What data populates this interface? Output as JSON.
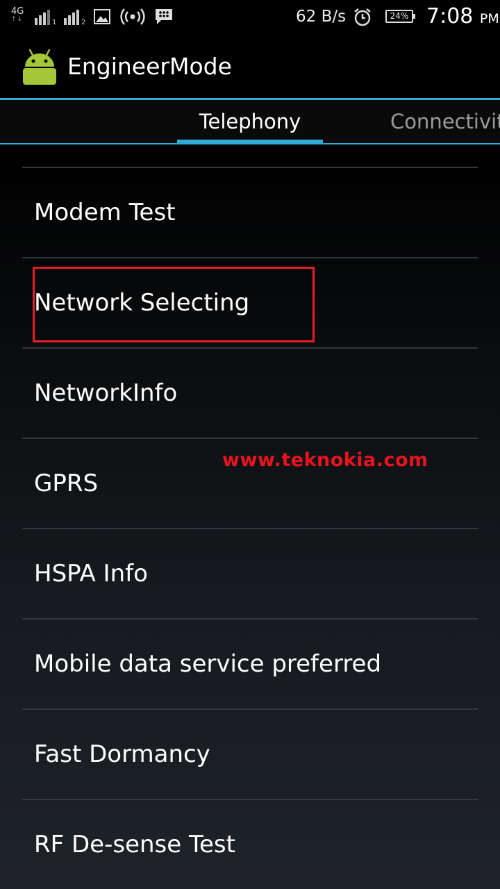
{
  "status_bar": {
    "network_type": "4G",
    "sim1_label": "1",
    "sim2_label": "2",
    "data_rate": "62 B/s",
    "battery": "24%",
    "time": "7:08",
    "ampm": "PM",
    "icons": [
      "lte-icon",
      "signal-sim1-icon",
      "signal-sim2-icon",
      "image-icon",
      "hotspot-icon",
      "bbm-icon",
      "alarm-icon",
      "battery-icon"
    ]
  },
  "app_bar": {
    "title": "EngineerMode",
    "icon": "android-icon"
  },
  "tabs": [
    {
      "label": "Telephony",
      "selected": true
    },
    {
      "label": "Connectivit",
      "selected": false
    }
  ],
  "list": {
    "items": [
      "Modem Test",
      "Network Selecting",
      "NetworkInfo",
      "GPRS",
      "HSPA Info",
      "Mobile data service preferred",
      "Fast Dormancy",
      "RF De-sense Test"
    ],
    "highlighted_item": "Network Selecting"
  },
  "watermark": "www.teknokia.com",
  "colors": {
    "accent": "#33a9d6",
    "highlight": "#e61e2a",
    "watermark": "#e8141f",
    "android_green": "#a4c639"
  }
}
